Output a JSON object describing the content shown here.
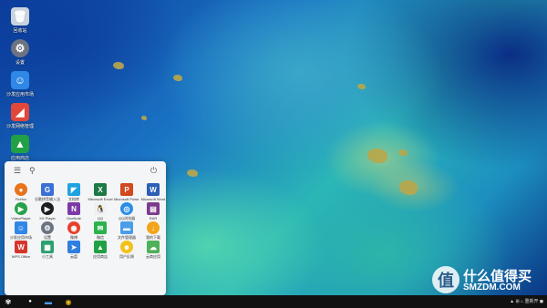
{
  "desktop": {
    "icons": [
      {
        "name": "recycle-bin-icon",
        "label": "回收站",
        "glyph": "🗑",
        "color": "#c8d3de"
      },
      {
        "name": "settings-icon",
        "label": "设置",
        "glyph": "⚙",
        "color": "#6b7480"
      },
      {
        "name": "app-store-icon",
        "label": "沙发应用市场",
        "glyph": "☺",
        "color": "#2f87e6"
      },
      {
        "name": "network-manager-icon",
        "label": "沙发网络管理",
        "glyph": "◢",
        "color": "#e2473b"
      },
      {
        "name": "app-mall-icon",
        "label": "应用商店",
        "glyph": "▲",
        "color": "#21a045"
      }
    ]
  },
  "start_menu": {
    "menu_icon": "☰",
    "search_icon": "⚲",
    "power_icon": "⏻",
    "apps": [
      {
        "label": "Firefox",
        "glyph": "●",
        "color": "#e8731b"
      },
      {
        "label": "谷歌拼音输入法",
        "glyph": "G",
        "color": "#3b6fd6"
      },
      {
        "label": "文档库",
        "glyph": "◤",
        "color": "#1fa3e0"
      },
      {
        "label": "Microsoft Excel",
        "glyph": "X",
        "color": "#1d7a45"
      },
      {
        "label": "Microsoft Powe...",
        "glyph": "P",
        "color": "#d2491f"
      },
      {
        "label": "Microsoft Word",
        "glyph": "W",
        "color": "#2b5fb4"
      },
      {
        "label": "VideoPlayer",
        "glyph": "▶",
        "color": "#27a14a"
      },
      {
        "label": "XX Player",
        "glyph": "▶",
        "color": "#1d1d1d"
      },
      {
        "label": "OneNote",
        "glyph": "N",
        "color": "#7c3aa8"
      },
      {
        "label": "QQ",
        "glyph": "🐧",
        "color": "#f0f0f0"
      },
      {
        "label": "QQ浏览器",
        "glyph": "◎",
        "color": "#2a8de6"
      },
      {
        "label": "RAR",
        "glyph": "▤",
        "color": "#7b3b8c"
      },
      {
        "label": "沙发应用市场",
        "glyph": "☺",
        "color": "#2f87e6"
      },
      {
        "label": "设置",
        "glyph": "⚙",
        "color": "#6b7480"
      },
      {
        "label": "微博",
        "glyph": "◉",
        "color": "#e6412e"
      },
      {
        "label": "微信",
        "glyph": "✉",
        "color": "#2bb24c"
      },
      {
        "label": "文件管理器",
        "glyph": "▬",
        "color": "#4a9de8"
      },
      {
        "label": "我的下载",
        "glyph": "↓",
        "color": "#f2a51a"
      },
      {
        "label": "WPS Office",
        "glyph": "W",
        "color": "#d7352b"
      },
      {
        "label": "小工具",
        "glyph": "▦",
        "color": "#2e9f6f"
      },
      {
        "label": "云盘",
        "glyph": "➤",
        "color": "#2f7fe0"
      },
      {
        "label": "应用商店",
        "glyph": "▲",
        "color": "#21a045"
      },
      {
        "label": "用户反馈",
        "glyph": "☻",
        "color": "#f2c21b"
      },
      {
        "label": "云商应用",
        "glyph": "☁",
        "color": "#4fb05a"
      }
    ]
  },
  "taskbar": {
    "start_icon": "✾",
    "search_icon": "●",
    "files_icon": "▬",
    "active_icon": "◉",
    "tray_text": "▲  ⊞  ⌂  重新开  ◼"
  },
  "watermark": {
    "badge": "值",
    "line1": "什么值得买",
    "line2": "SMZDM.COM"
  }
}
